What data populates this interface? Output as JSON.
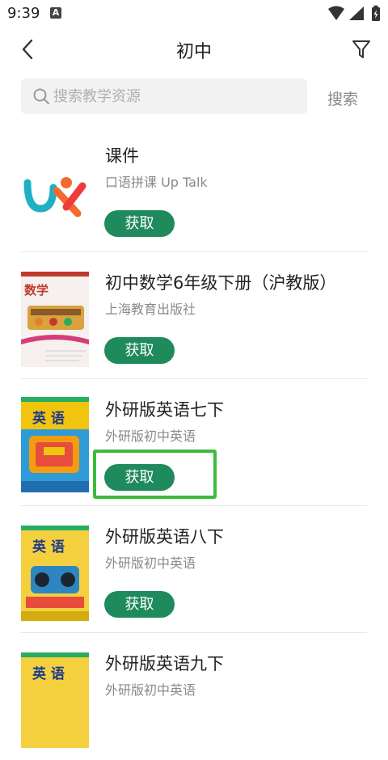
{
  "status_bar": {
    "time": "9:39",
    "notification_icon": "a-letter-icon"
  },
  "header": {
    "title": "初中"
  },
  "search": {
    "placeholder": "搜索教学资源",
    "value": "",
    "button_label": "搜索"
  },
  "colors": {
    "accent_green": "#1f8a5b",
    "highlight_green": "#3dbb3d"
  },
  "items": [
    {
      "title": "课件",
      "subtitle": "口语拼课 Up Talk",
      "button": "获取",
      "thumb_type": "logo",
      "thumb_text": ""
    },
    {
      "title": "初中数学6年级下册（沪教版）",
      "subtitle": "上海教育出版社",
      "button": "获取",
      "thumb_type": "cover-math",
      "thumb_text": "数学"
    },
    {
      "title": "外研版英语七下",
      "subtitle": "外研版初中英语",
      "button": "获取",
      "thumb_type": "cover-english",
      "thumb_text": "英 语"
    },
    {
      "title": "外研版英语八下",
      "subtitle": "外研版初中英语",
      "button": "获取",
      "thumb_type": "cover-english",
      "thumb_text": "英 语"
    },
    {
      "title": "外研版英语九下",
      "subtitle": "外研版初中英语",
      "button": "获取",
      "thumb_type": "cover-english",
      "thumb_text": "英 语"
    }
  ]
}
